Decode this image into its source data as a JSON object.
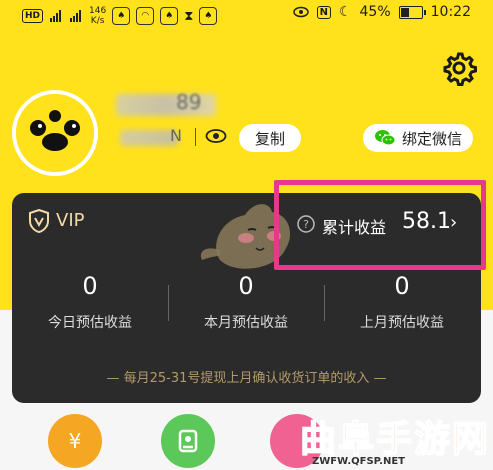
{
  "status_bar": {
    "hd_badge": "HD",
    "network_speed": "146",
    "network_speed_unit": "K/s",
    "battery_percent": "45%",
    "time": "10:22",
    "icons": [
      "hd-icon",
      "signal-4g-icon",
      "signal-4g-icon",
      "notification-app-icon",
      "notification-app-icon",
      "notification-app-icon",
      "hourglass-icon",
      "notification-app-icon",
      "eye-comfort-icon",
      "nfc-icon",
      "no-disturb-icon",
      "battery-icon"
    ]
  },
  "header": {
    "name_visible_suffix": "89",
    "id_visible_suffix": "N",
    "copy_label": "复制",
    "bind_wechat_label": "绑定微信",
    "icons": [
      "gear-icon",
      "avatar",
      "eye-icon",
      "wechat-icon"
    ]
  },
  "card": {
    "vip_label": "VIP",
    "cumulative_label": "累计收益",
    "cumulative_value": "58.1",
    "chevron": "›",
    "stats": [
      {
        "value": "0",
        "label": "今日预估收益"
      },
      {
        "value": "0",
        "label": "本月预估收益"
      },
      {
        "value": "0",
        "label": "上月预估收益"
      }
    ],
    "note": "— 每月25-31号提现上月确认收货订单的收入 —"
  },
  "bottom_icons": [
    {
      "symbol": "¥",
      "color": "#F5A623"
    },
    {
      "symbol": "",
      "color": "#5CC85A"
    },
    {
      "symbol": "",
      "color": "#F06292"
    }
  ],
  "watermark": {
    "text": "曲阜手游网",
    "url": "ZWFW.QFSP.NET"
  },
  "colors": {
    "header_yellow": "#FFE21C",
    "card_dark": "#2B2B2B",
    "highlight_pink": "#E6398C",
    "gold_text": "#F3D9A4"
  }
}
